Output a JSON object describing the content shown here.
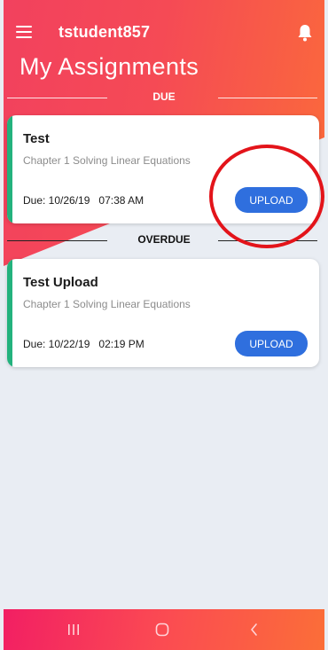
{
  "header": {
    "username": "tstudent857",
    "title": "My Assignments"
  },
  "sections": {
    "due": "DUE",
    "overdue": "OVERDUE"
  },
  "assignments": [
    {
      "title": "Test",
      "subtitle": "Chapter 1 Solving Linear Equations",
      "due_date": "Due: 10/26/19",
      "due_time": "07:38 AM",
      "button": "UPLOAD"
    },
    {
      "title": "Test Upload",
      "subtitle": "Chapter 1 Solving Linear Equations",
      "due_date": "Due: 10/22/19",
      "due_time": "02:19 PM",
      "button": "UPLOAD"
    }
  ],
  "icons": {
    "menu": "menu-icon",
    "notifications": "bell-icon",
    "nav_recents": "recents-icon",
    "nav_home": "home-icon",
    "nav_back": "back-icon"
  },
  "colors": {
    "accent": "#23b27d",
    "button": "#2f6fde",
    "header_gradient_start": "#f2415e",
    "header_gradient_end": "#fb6b3a",
    "annotation": "#e3141a"
  }
}
